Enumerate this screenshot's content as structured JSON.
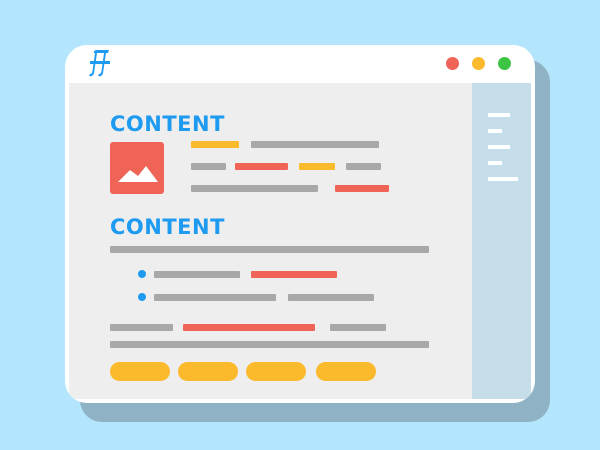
{
  "colors": {
    "background": "#b3e5fc",
    "accent_blue": "#1e9bf0",
    "text_gray": "#a8a8a8",
    "red": "#f06457",
    "yellow": "#fbb92c",
    "green": "#3ec444",
    "sidebar": "#c5dde8",
    "content_bg": "#eeeeee"
  },
  "window": {
    "logo": "𝕯",
    "controls": [
      "close",
      "minimize",
      "maximize"
    ]
  },
  "sections": [
    {
      "heading": "CONTENT"
    },
    {
      "heading": "CONTENT"
    }
  ],
  "icons": {
    "image": "image-icon",
    "logo": "brand-logo-icon"
  }
}
